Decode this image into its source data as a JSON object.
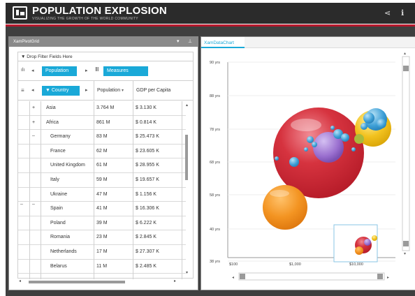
{
  "app": {
    "title": "POPULATION EXPLOSION",
    "subtitle": "VISUALIZING THE GROWTH OF THE WORLD COMMUNITY"
  },
  "colors": {
    "accent": "#1aa9d8",
    "brand_red": "#b7172c",
    "header": "#2b2b2b",
    "workspace": "#3f3f3f"
  },
  "header_icons": [
    "share-icon",
    "info-icon"
  ],
  "pivot": {
    "panel_title": "XamPivotGrid",
    "filter_label": "Drop Filter Fields Here",
    "columns_chip": "Population",
    "measures_chip": "Measures",
    "rows_chip": "Country",
    "headers": [
      "Population",
      "GDP per Capita"
    ],
    "rows": [
      {
        "name": "Asia",
        "expand": "+",
        "population": "3.764 M",
        "gdp": "$ 3.130 K",
        "level": 1
      },
      {
        "name": "Africa",
        "expand": "+",
        "population": "861 M",
        "gdp": "$ 0.814 K",
        "level": 1
      },
      {
        "name": "Germany",
        "population": "83 M",
        "gdp": "$ 25.473 K",
        "level": 2
      },
      {
        "name": "France",
        "population": "62 M",
        "gdp": "$ 23.605 K",
        "level": 2
      },
      {
        "name": "United Kingdom",
        "population": "61 M",
        "gdp": "$ 28.955 K",
        "level": 2
      },
      {
        "name": "Italy",
        "population": "59 M",
        "gdp": "$ 19.657 K",
        "level": 2
      },
      {
        "name": "Ukraine",
        "population": "47 M",
        "gdp": "$ 1.156 K",
        "level": 2
      },
      {
        "name": "Spain",
        "population": "41 M",
        "gdp": "$ 16.306 K",
        "level": 2
      },
      {
        "name": "Poland",
        "population": "39 M",
        "gdp": "$ 6.222 K",
        "level": 2
      },
      {
        "name": "Romania",
        "population": "23 M",
        "gdp": "$ 2.845 K",
        "level": 2
      },
      {
        "name": "Netherlands",
        "population": "17 M",
        "gdp": "$ 27.307 K",
        "level": 2
      },
      {
        "name": "Belarus",
        "population": "11 M",
        "gdp": "$ 2.485 K",
        "level": 2
      }
    ]
  },
  "chart": {
    "tab_label": "XamDataChart",
    "y_ticks": [
      "90 yrs",
      "88 yrs",
      "78 yrs",
      "68 yrs",
      "58 yrs",
      "40 yrs",
      "38 yrs"
    ],
    "x_ticks": [
      "$100",
      "$1,000",
      "$10,000"
    ]
  },
  "chart_data": {
    "type": "scatter",
    "xlabel": "",
    "ylabel": "",
    "x_scale": "log",
    "x_ticks": [
      "$100",
      "$1,000",
      "$10,000"
    ],
    "y_ticks": [
      "90 yrs",
      "88 yrs",
      "78 yrs",
      "68 yrs",
      "58 yrs",
      "40 yrs",
      "38 yrs"
    ],
    "series": [
      {
        "name": "",
        "points": [
          {
            "x": 3130,
            "y": 70,
            "size": 3764,
            "color": "#d4323f"
          },
          {
            "x": 814,
            "y": 52,
            "size": 861,
            "color": "#f39422"
          },
          {
            "x": 25473,
            "y": 80,
            "size": 83,
            "color": "#f2c21f"
          },
          {
            "x": 23605,
            "y": 81,
            "size": 62,
            "color": "#4aa8dc"
          },
          {
            "x": 19657,
            "y": 81,
            "size": 59,
            "color": "#4aa8dc"
          },
          {
            "x": 2000,
            "y": 75,
            "size": 150,
            "color": "#9a6fcf"
          }
        ]
      }
    ]
  }
}
